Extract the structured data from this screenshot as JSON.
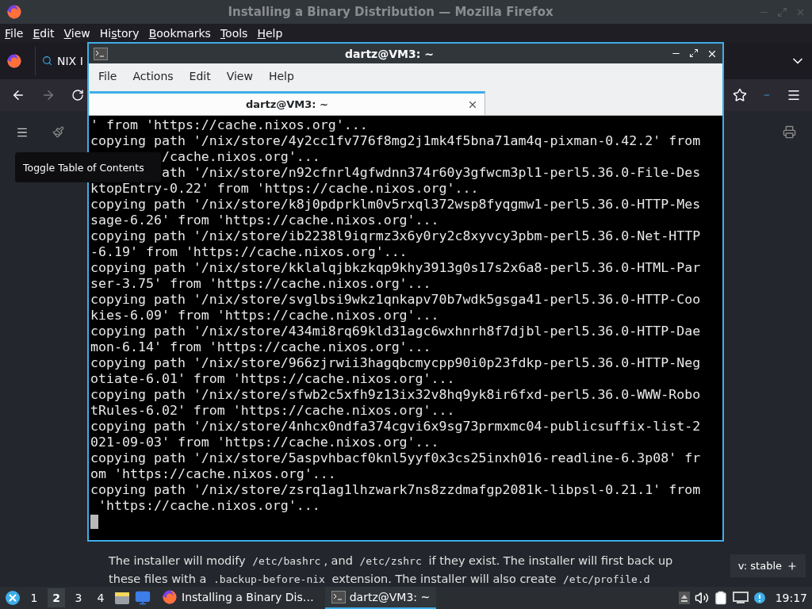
{
  "firefox": {
    "title": "Installing a Binary Distribution — Mozilla Firefox",
    "menu": [
      {
        "key": "F",
        "after": "ile"
      },
      {
        "key": "E",
        "after": "dit"
      },
      {
        "key": "V",
        "after": "iew"
      },
      {
        "before": "Hi",
        "key": "s",
        "after": "tory"
      },
      {
        "key": "B",
        "after": "ookmarks"
      },
      {
        "key": "T",
        "after": "ools"
      },
      {
        "key": "H",
        "after": "elp"
      }
    ],
    "tabs": [
      {
        "label": "NIX I",
        "selected": true
      }
    ],
    "tooltip": "Toggle Table of Contents",
    "paragraph": [
      [
        {
          "kind": "text",
          "text": "The installer will modify "
        },
        {
          "kind": "code",
          "text": "/etc/bashrc"
        },
        {
          "kind": "text",
          "text": ", and "
        },
        {
          "kind": "code",
          "text": "/etc/zshrc"
        },
        {
          "kind": "text",
          "text": " if they exist. The installer will first back up"
        }
      ],
      [
        {
          "kind": "text",
          "text": "these files with a "
        },
        {
          "kind": "code",
          "text": ".backup-before-nix"
        },
        {
          "kind": "text",
          "text": " extension. The installer will also create "
        },
        {
          "kind": "code",
          "text": "/etc/profile.d"
        }
      ]
    ],
    "version_badge": "v: stable"
  },
  "terminal": {
    "title": "dartz@VM3: ~",
    "menu": [
      "File",
      "Actions",
      "Edit",
      "View",
      "Help"
    ],
    "tabs": [
      {
        "label": "dartz@VM3: ~",
        "selected": true
      }
    ],
    "lines": [
      "' from 'https://cache.nixos.org'...",
      "copying path '/nix/store/4y2cc1fv776f8mg2j1mk4f5bna71am4q-pixman-0.42.2' from",
      "         /cache.nixos.org'...",
      "         ath '/nix/store/n92cfnrl4gfwdnn374r60y3gfwcm3pl1-perl5.36.0-File-Des",
      "ktopEntry-0.22' from 'https://cache.nixos.org'...",
      "copying path '/nix/store/k8j0pdprklm0v5rxql372wsp8fyqgmw1-perl5.36.0-HTTP-Mes",
      "sage-6.26' from 'https://cache.nixos.org'...",
      "copying path '/nix/store/ib2238l9iqrmz3x6y0ry2c8xyvcy3pbm-perl5.36.0-Net-HTTP",
      "-6.19' from 'https://cache.nixos.org'...",
      "copying path '/nix/store/kklalqjbkzkqp9khy3913g0s17s2x6a8-perl5.36.0-HTML-Par",
      "ser-3.75' from 'https://cache.nixos.org'...",
      "copying path '/nix/store/svglbsi9wkz1qnkapv70b7wdk5gsga41-perl5.36.0-HTTP-Coo",
      "kies-6.09' from 'https://cache.nixos.org'...",
      "copying path '/nix/store/434mi8rq69kld31agc6wxhnrh8f7djbl-perl5.36.0-HTTP-Dae",
      "mon-6.14' from 'https://cache.nixos.org'...",
      "copying path '/nix/store/966zjrwii3hagqbcmycpp90i0p23fdkp-perl5.36.0-HTTP-Neg",
      "otiate-6.01' from 'https://cache.nixos.org'...",
      "copying path '/nix/store/sfwb2c5xfh9z13ix32v8hq9yk8ir6fxd-perl5.36.0-WWW-Robo",
      "tRules-6.02' from 'https://cache.nixos.org'...",
      "copying path '/nix/store/4nhcx0ndfa374cgvi6x9sg73prmxmc04-publicsuffix-list-2",
      "021-09-03' from 'https://cache.nixos.org'...",
      "copying path '/nix/store/5aspvhbacf0knl5yyf0x3cs25inxh016-readline-6.3p08' fr",
      "om 'https://cache.nixos.org'...",
      "copying path '/nix/store/zsrq1ag1lhzwark7ns8zzdmafgp2081k-libpsl-0.21.1' from",
      " 'https://cache.nixos.org'..."
    ]
  },
  "taskbar": {
    "workspaces": [
      {
        "label": "1",
        "selected": false
      },
      {
        "label": "2",
        "selected": true
      },
      {
        "label": "3",
        "selected": false
      },
      {
        "label": "4",
        "selected": false
      }
    ],
    "tasks": [
      {
        "kind": "browser",
        "label": "Installing a Binary Dis…",
        "selected": false
      },
      {
        "kind": "terminal",
        "label": "dartz@VM3: ~",
        "selected": true
      }
    ],
    "clock": "19:17"
  }
}
